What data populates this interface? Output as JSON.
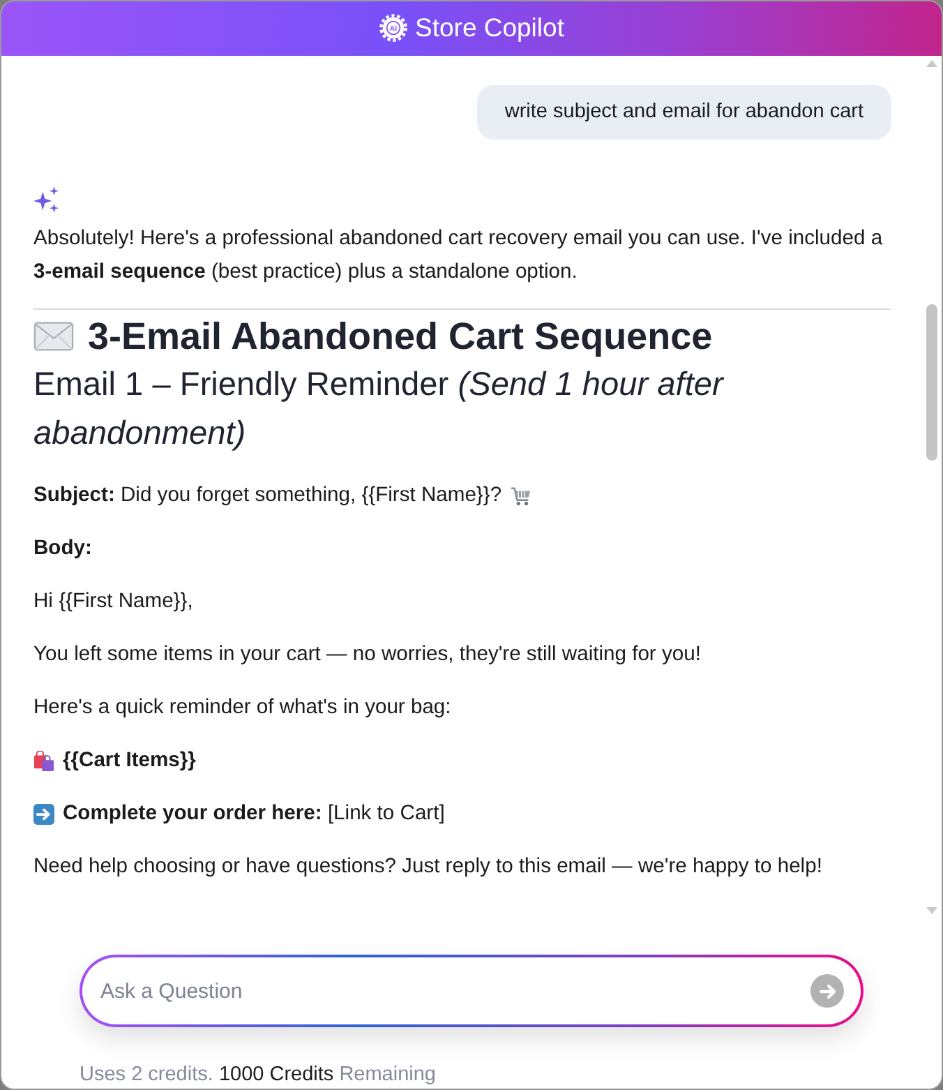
{
  "header": {
    "badge": "AI",
    "title": "Store Copilot"
  },
  "messages": [
    {
      "kind": "user",
      "text": "write subject and email for abandon cart"
    },
    {
      "kind": "assistant",
      "blocks": [
        {
          "kind": "paragraph",
          "text": "Absolutely! Here's a professional abandoned cart recovery email you can use. I've included a **3-email sequence** (best practice) plus a standalone option."
        },
        {
          "kind": "section_heading",
          "text": "3-Email Abandoned Cart Sequence"
        },
        {
          "kind": "subheading",
          "text": "Email 1 – Friendly Reminder *(Send 1 hour after abandonment)*"
        },
        {
          "kind": "subject",
          "text": "**Subject:** Did you forget something, {{First Name}}?"
        },
        {
          "kind": "label",
          "text": "Body:"
        },
        {
          "kind": "paragraph",
          "text": "Hi {{First Name}},"
        },
        {
          "kind": "paragraph",
          "text": "You left some items in your cart — no worries, they're still waiting for you!"
        },
        {
          "kind": "paragraph",
          "text": "Here's a quick reminder of what's in your bag:"
        },
        {
          "kind": "cart_items",
          "text": "{{Cart Items}}"
        },
        {
          "kind": "cta",
          "text": "**Complete your order here:** [Link to Cart]"
        },
        {
          "kind": "paragraph",
          "text": "Need help choosing or have questions? Just reply to this email — we're happy to help!"
        }
      ]
    }
  ],
  "composer": {
    "placeholder": "Ask a Question"
  },
  "footer": {
    "note": "Uses 2 credits.",
    "credits": "1000 Credits",
    "remaining": "Remaining"
  }
}
